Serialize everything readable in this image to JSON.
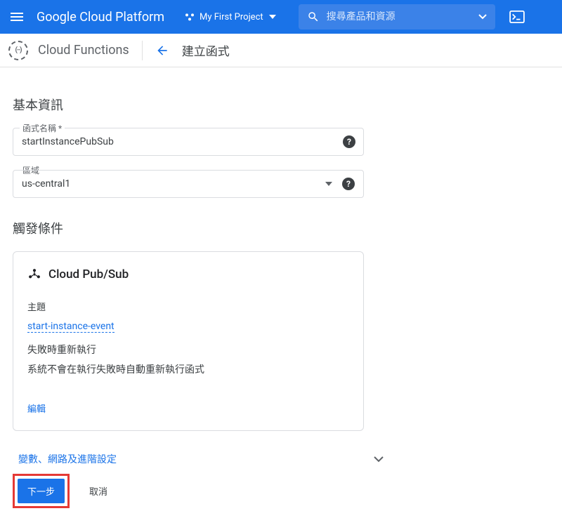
{
  "header": {
    "platform_name": "Google Cloud Platform",
    "project_name": "My First Project",
    "search_placeholder": "搜尋產品和資源"
  },
  "subheader": {
    "service_name": "Cloud Functions",
    "page_title": "建立函式"
  },
  "basic_info": {
    "section_title": "基本資訊",
    "function_name_label": "函式名稱 *",
    "function_name_value": "startInstancePubSub",
    "region_label": "區域",
    "region_value": "us-central1"
  },
  "trigger": {
    "section_title": "觸發條件",
    "type": "Cloud Pub/Sub",
    "topic_label": "主題",
    "topic_value": "start-instance-event",
    "retry_title": "失敗時重新執行",
    "retry_desc": "系統不會在執行失敗時自動重新執行函式",
    "edit": "編輯"
  },
  "advanced": {
    "label": "變數、網路及進階設定"
  },
  "footer": {
    "next": "下一步",
    "cancel": "取消"
  }
}
